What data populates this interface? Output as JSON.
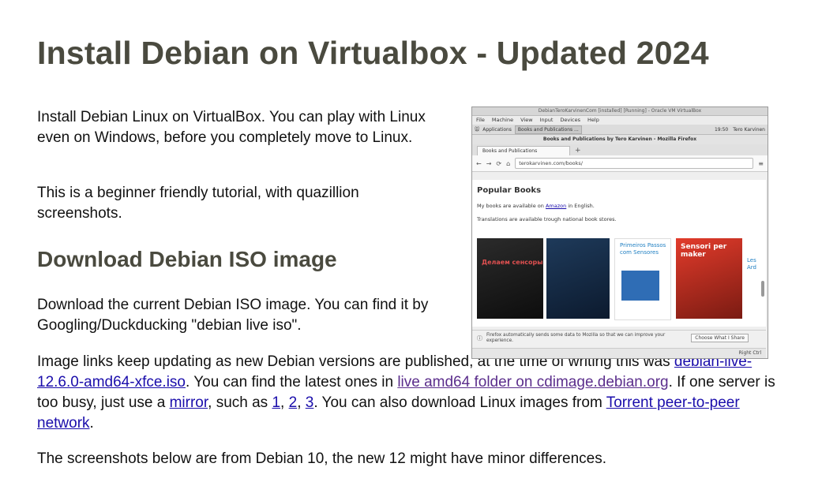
{
  "title": "Install Debian on Virtualbox - Updated 2024",
  "intro": {
    "p1": "Install Debian Linux on VirtualBox. You can play with Linux even on Windows, before you completely move to Linux.",
    "p2": "This is a beginner friendly tutorial, with quazillion screenshots."
  },
  "download": {
    "heading": "Download Debian ISO image",
    "p1": "Download the current Debian ISO image. You can find it by Googling/Duckducking \"debian live iso\".",
    "p2_part1": "Image links keep updating as new Debian versions are published, at the time of writing this was ",
    "iso_link": "debian-live-12.6.0-amd64-xfce.iso",
    "p2_part2": ". You can find the latest ones in ",
    "folder_link": "live amd64 folder on cdimage.debian.org",
    "p2_part3": ". If one server is too busy, just use a ",
    "mirror_link": "mirror",
    "p2_part4": ", such as ",
    "mirror1": "1",
    "comma1": ", ",
    "mirror2": "2",
    "comma2": ", ",
    "mirror3": "3",
    "p2_part5": ". You can also download Linux images from ",
    "torrent_link": "Torrent peer-to-peer network",
    "p2_part6": ".",
    "p3": "The screenshots below are from Debian 10, the new 12 might have minor differences."
  },
  "screenshot": {
    "vb_title": "DebianTeroKarvinenCom [installed] [Running] - Oracle VM VirtualBox",
    "vb_menu": [
      "File",
      "Machine",
      "View",
      "Input",
      "Devices",
      "Help"
    ],
    "taskbar_apps": "Applications",
    "taskbar_task": "Books and Publications ...",
    "clock": "19:50",
    "user": "Tero Karvinen",
    "ff_title": "Books and Publications by Tero Karvinen - Mozilla Firefox",
    "tab_label": "Books and Publications",
    "url": "terokarvinen.com/books/",
    "popular_books": "Popular Books",
    "line1_pre": "My books are available on ",
    "line1_link": "Amazon",
    "line1_post": " in English.",
    "line2": "Translations are available trough national book stores.",
    "book1": "Делаем сенсоры",
    "book3": "Primeiros Passos com Sensores",
    "book4": "Sensori per maker",
    "book5": "Les Ard",
    "notice": "Firefox automatically sends some data to Mozilla so that we can improve your experience.",
    "notice_btn": "Choose What I Share",
    "status_right": "Right Ctrl",
    "colors": {
      "heading": "#4a4a3f",
      "link": "#1a0dab",
      "visited": "#5b2e8c"
    }
  }
}
